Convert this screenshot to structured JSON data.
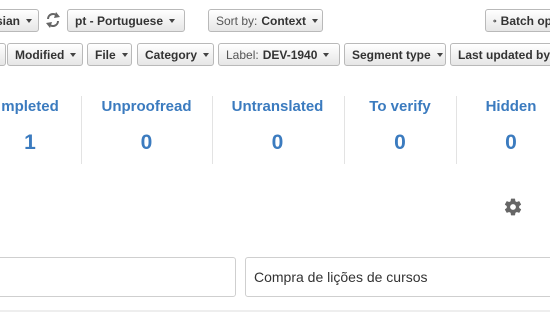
{
  "toolbar": {
    "source_language": "sian",
    "target_language": "pt - Portuguese",
    "sort_label": "Sort by:",
    "sort_value": "Context",
    "batch_label": "Batch op"
  },
  "filters": {
    "modified": "Modified",
    "file": "File",
    "category": "Category",
    "label_prefix": "Label:",
    "label_value": "DEV-1940",
    "segment_type": "Segment type",
    "last_updated": "Last updated by"
  },
  "stats": [
    {
      "label": "mpleted",
      "value": "1"
    },
    {
      "label": "Unproofread",
      "value": "0"
    },
    {
      "label": "Untranslated",
      "value": "0"
    },
    {
      "label": "To verify",
      "value": "0"
    },
    {
      "label": "Hidden",
      "value": "0"
    }
  ],
  "editor": {
    "source_text": "",
    "target_text": "Compra de lições de cursos"
  },
  "colors": {
    "accent": "#3b7bbf"
  },
  "icons": {
    "swap": "swap-arrows-icon",
    "settings": "gear-icon",
    "batch": "gear-icon"
  }
}
